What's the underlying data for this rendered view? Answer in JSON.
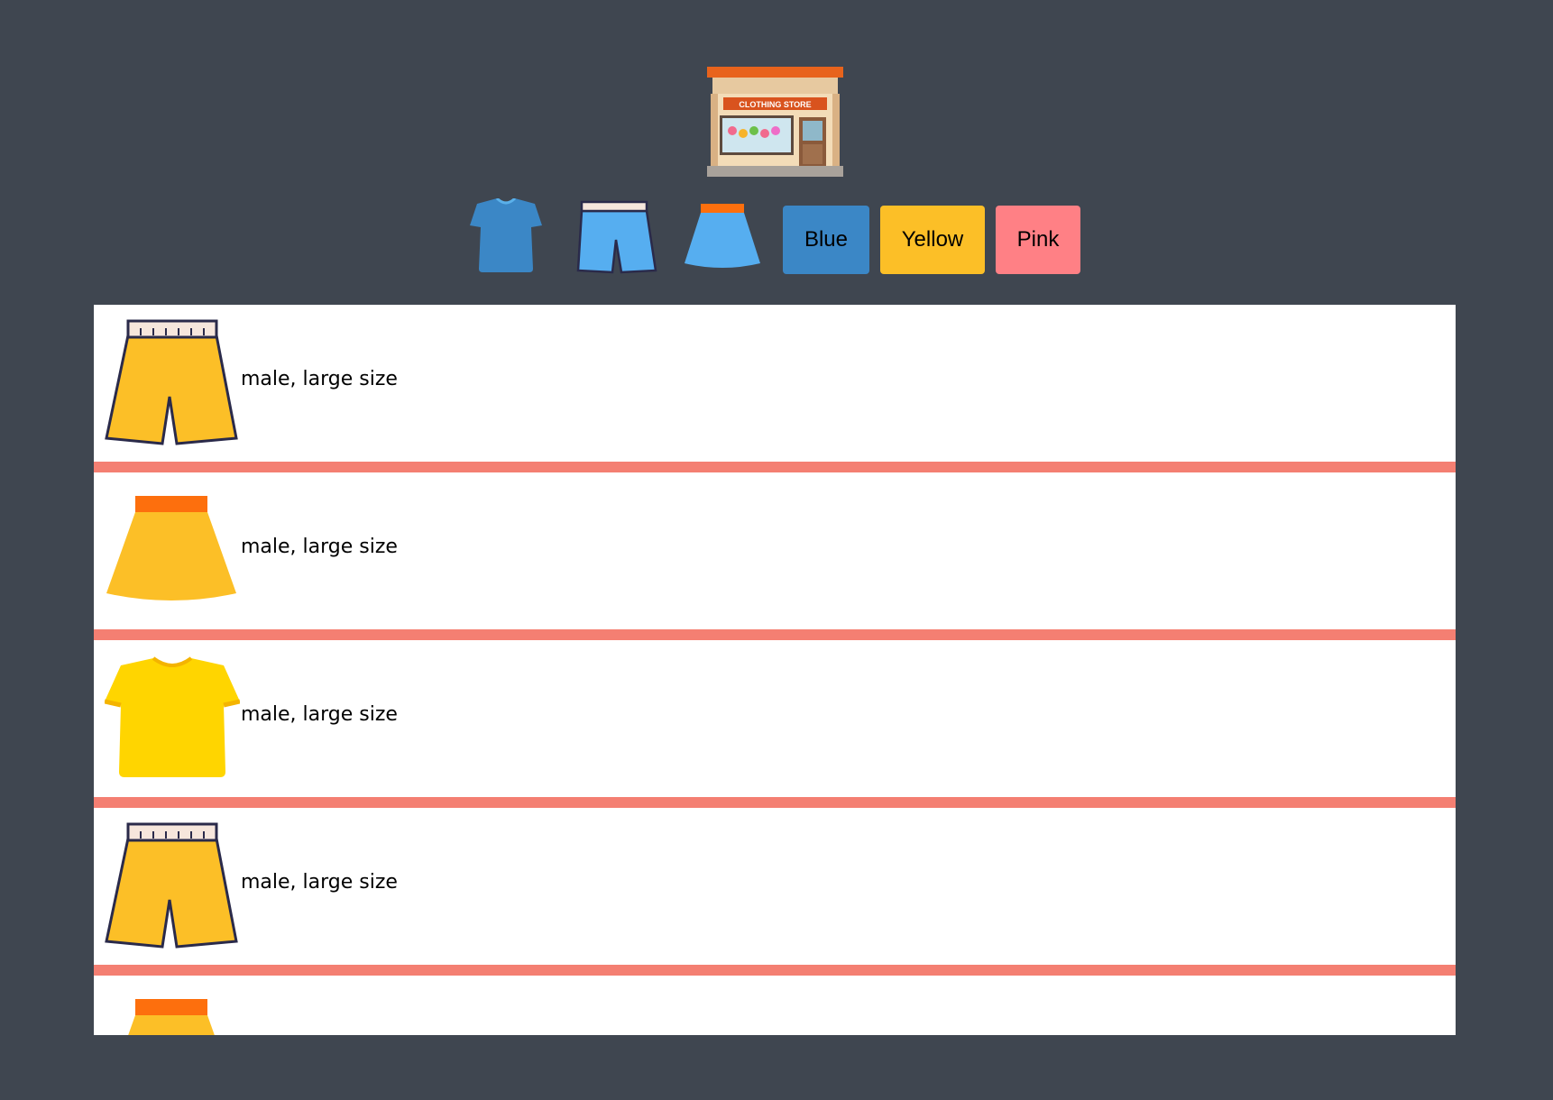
{
  "header": {
    "logo_icon": "clothing-store-icon",
    "logo_sign": "CLOTHING STORE"
  },
  "filters": {
    "type_icons": [
      "tshirt-icon",
      "shorts-icon",
      "skirt-icon"
    ],
    "colors": [
      {
        "label": "Blue",
        "color": "#3b87c6"
      },
      {
        "label": "Yellow",
        "color": "#fcbf27"
      },
      {
        "label": "Pink",
        "color": "#ff8085"
      }
    ]
  },
  "items": [
    {
      "icon": "shorts-icon",
      "color": "#fcbf27",
      "description": "male, large size"
    },
    {
      "icon": "skirt-icon",
      "color": "#fcbf27",
      "description": "male, large size"
    },
    {
      "icon": "tshirt-icon",
      "color": "#ffd500",
      "description": "male, large size"
    },
    {
      "icon": "shorts-icon",
      "color": "#fcbf27",
      "description": "male, large size"
    },
    {
      "icon": "skirt-icon",
      "color": "#fcbf27",
      "description": ""
    }
  ],
  "theme": {
    "background": "#3f4650",
    "separator": "#f47f72",
    "panel": "#ffffff"
  }
}
